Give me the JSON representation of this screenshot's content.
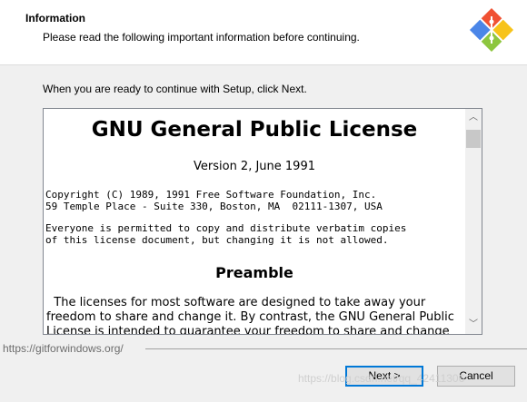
{
  "header": {
    "title": "Information",
    "subtitle": "Please read the following important information before continuing."
  },
  "prompt": "When you are ready to continue with Setup, click Next.",
  "license": {
    "title": "GNU General Public License",
    "version": "Version 2, June 1991",
    "copyright_line1": "Copyright (C) 1989, 1991 Free Software Foundation, Inc.",
    "copyright_line2": "59 Temple Place - Suite 330, Boston, MA  02111-1307, USA",
    "permission_line1": "Everyone is permitted to copy and distribute verbatim copies",
    "permission_line2": "of this license document, but changing it is not allowed.",
    "preamble_heading": "Preamble",
    "preamble_lines": [
      "  The licenses for most software are designed to take away your",
      "freedom to share and change it. By contrast, the GNU General Public",
      "License is intended to guarantee your freedom to share and change"
    ]
  },
  "footer": {
    "url": "https://gitforwindows.org/",
    "watermark": "https://blog.csdn.net/qq_42411306"
  },
  "buttons": {
    "next": "Next >",
    "cancel": "Cancel"
  },
  "icons": {
    "logo": "git-diamond-logo-icon",
    "scroll_up": "chevron-up-icon",
    "scroll_down": "chevron-down-icon"
  },
  "colors": {
    "accent": "#0078d7",
    "logo_red": "#f05133",
    "logo_yellow": "#f7c31a",
    "logo_green": "#8dc63f",
    "logo_blue": "#4b86e8"
  }
}
